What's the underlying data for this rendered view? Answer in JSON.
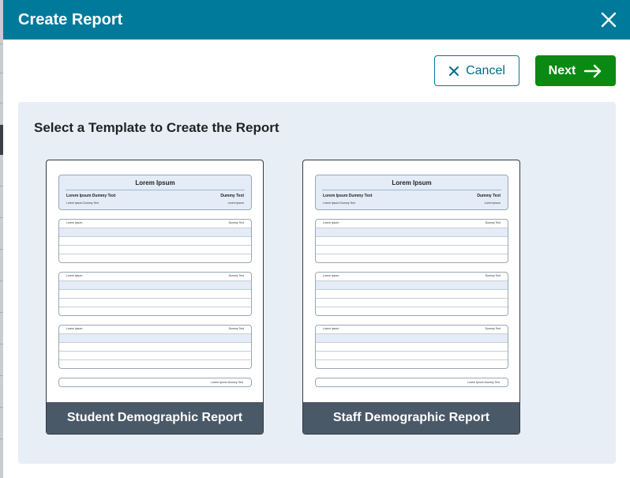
{
  "dialog": {
    "title": "Create Report",
    "close_icon": "close-icon"
  },
  "actions": {
    "cancel_label": "Cancel",
    "cancel_icon": "x-icon",
    "next_label": "Next",
    "next_icon": "arrow-right-icon"
  },
  "panel": {
    "title": "Select a Template to Create the Report"
  },
  "templates": [
    {
      "label": "Student Demographic Report",
      "preview": {
        "title": "Lorem Ipsum",
        "left": "Lorem Ipsum Dummy Text",
        "right": "Dummy Text",
        "left_sub": "Lorem Ipsum Dummy Text",
        "right_sub": "Lorem Ipsum",
        "table_left": "Lorem Ipsum",
        "table_right": "Dummy Text",
        "footer": "Lorem Ipsum Dummy Text"
      }
    },
    {
      "label": "Staff Demographic Report",
      "preview": {
        "title": "Lorem Ipsum",
        "left": "Lorem Ipsum Dummy Text",
        "right": "Dummy Text",
        "left_sub": "Lorem Ipsum Dummy Text",
        "right_sub": "Lorem Ipsum",
        "table_left": "Lorem Ipsum",
        "table_right": "Dummy Text",
        "footer": "Lorem Ipsum Dummy Text"
      }
    }
  ],
  "colors": {
    "header": "#007a9a",
    "next_button": "#0a8a12",
    "card_footer": "#4a5968",
    "panel_bg": "#e8eef6"
  }
}
